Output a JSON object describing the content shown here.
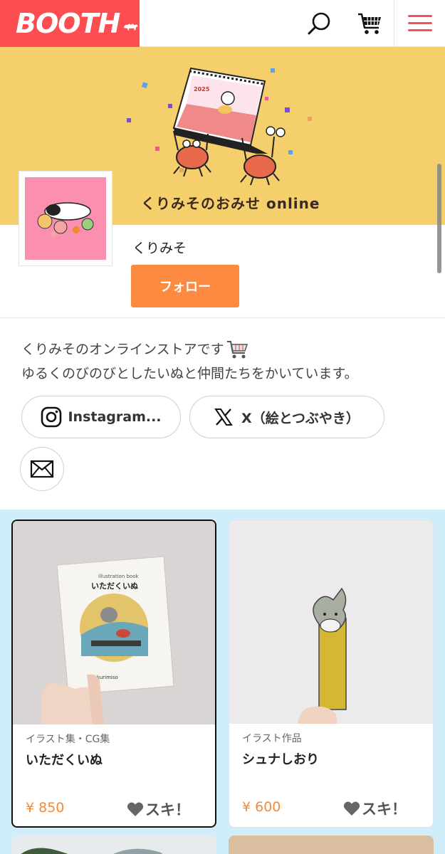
{
  "header": {
    "logo_text": "BOOTH",
    "brand_color": "#fc4d50",
    "icons": [
      "search-icon",
      "cart-icon",
      "menu-icon"
    ]
  },
  "banner": {
    "title": "くりみそのおみせ online",
    "calendar_year": "2025",
    "background": "#f5cf6b"
  },
  "shop": {
    "name": "くりみそ",
    "follow_label": "フォロー",
    "description_line1": "くりみそのオンラインストアです",
    "description_line2": "ゆるくのびのびとしたいぬと仲間たちをかいています。",
    "links": [
      {
        "label": "Instagram...",
        "icon": "instagram-icon"
      },
      {
        "label": "X（絵とつぶやき）",
        "icon": "x-logo-icon"
      }
    ],
    "mail_icon": "mail-icon"
  },
  "products": [
    {
      "category": "イラスト集・CG集",
      "title": "いただくいぬ",
      "price": "¥ 850",
      "like_label": "スキ！",
      "book_title": "いただくいぬ",
      "book_subtitle": "illustration book",
      "book_author": "kurimiso"
    },
    {
      "category": "イラスト作品",
      "title": "シュナしおり",
      "price": "¥ 600",
      "like_label": "スキ！"
    }
  ],
  "colors": {
    "accent": "#fc8a40",
    "price": "#f28a39",
    "grid_bg": "#cfeefa"
  }
}
